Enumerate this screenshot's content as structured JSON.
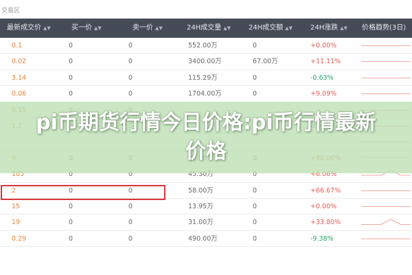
{
  "zone": {
    "title": "交易区"
  },
  "columns": [
    {
      "label": "最新成交价",
      "sortable": true
    },
    {
      "label": "买一价",
      "sortable": true
    },
    {
      "label": "卖一价",
      "sortable": true
    },
    {
      "label": "24H成交量",
      "sortable": true
    },
    {
      "label": "24H成交额",
      "sortable": true
    },
    {
      "label": "24H涨跌",
      "sortable": true
    },
    {
      "label": "价格趋势(3日)",
      "sortable": false
    }
  ],
  "rows": [
    {
      "price": "0.1",
      "buy": "0",
      "sell": "0",
      "volume": "552.00万",
      "amount": "0",
      "change": "+0.00%",
      "dir": "up",
      "trend": [
        0.5,
        0.5,
        0.5,
        0.5,
        0.5,
        0.5
      ]
    },
    {
      "price": "0.02",
      "buy": "0",
      "sell": "0",
      "volume": "3400.00万",
      "amount": "67.00万",
      "change": "+11.11%",
      "dir": "up",
      "trend": [
        0.5,
        0.5,
        0.5,
        0.5,
        0.5,
        0.5
      ]
    },
    {
      "price": "3.14",
      "buy": "0",
      "sell": "0",
      "volume": "115.29万",
      "amount": "0",
      "change": "-0.63%",
      "dir": "down",
      "trend": [
        0.5,
        0.5,
        0.5,
        0.5,
        0.5,
        0.5
      ]
    },
    {
      "price": "0.06",
      "buy": "0",
      "sell": "0",
      "volume": "1704.00万",
      "amount": "0",
      "change": "+9.09%",
      "dir": "up",
      "trend": [
        0.5,
        0.5,
        0.5,
        0.5,
        0.5,
        0.5
      ]
    },
    {
      "price": "0.15",
      "buy": "0",
      "sell": "0",
      "volume": "",
      "amount": "",
      "change": "",
      "dir": "up",
      "trend": [
        0.5,
        0.5,
        0.5,
        0.5,
        0.5,
        0.5
      ]
    },
    {
      "price": "1.2",
      "buy": "0",
      "sell": "0",
      "volume": "",
      "amount": "",
      "change": "-89.09%",
      "dir": "down",
      "trend": [
        0.5,
        0.5,
        0.5,
        0.5,
        0.5,
        0.5
      ]
    },
    {
      "price": "",
      "buy": "",
      "sell": "",
      "volume": "",
      "amount": "",
      "change": "",
      "dir": "up",
      "trend": [
        0.5,
        0.5,
        0.5,
        0.5,
        0.5,
        0.5
      ]
    },
    {
      "price": "9",
      "buy": "0",
      "sell": "0",
      "volume": "55.30万",
      "amount": "0",
      "change": "+80.00%",
      "dir": "up",
      "trend": [
        0.4,
        0.4,
        0.4,
        0.4,
        0.4,
        0.4
      ]
    },
    {
      "price": "105",
      "buy": "0",
      "sell": "0",
      "volume": "45.30万",
      "amount": "0",
      "change": "+6.06%",
      "dir": "up",
      "trend": [
        0.6,
        0.6,
        0.6,
        0.1,
        0.6,
        0.6
      ]
    },
    {
      "price": "2",
      "buy": "0",
      "sell": "0",
      "volume": "58.00万",
      "amount": "0",
      "change": "+66.67%",
      "dir": "up",
      "trend": [
        0.5,
        0.5,
        0.5,
        0.5,
        0.5,
        0.5
      ]
    },
    {
      "price": "15",
      "buy": "0",
      "sell": "0",
      "volume": "13.95万",
      "amount": "0",
      "change": "+0.00%",
      "dir": "up",
      "trend": [
        0.5,
        0.5,
        0.5,
        0.5,
        0.5,
        0.5
      ]
    },
    {
      "price": "19",
      "buy": "0",
      "sell": "0",
      "volume": "31.00万",
      "amount": "0",
      "change": "+33.80%",
      "dir": "up",
      "trend": [
        0.7,
        0.7,
        0.7,
        0.2,
        0.7,
        0.7
      ]
    },
    {
      "price": "0.29",
      "buy": "0",
      "sell": "0",
      "volume": "490.00万",
      "amount": "0",
      "change": "-9.38%",
      "dir": "down",
      "trend": [
        0.5,
        0.5,
        0.5,
        0.5,
        0.5,
        0.5
      ]
    }
  ],
  "banner": {
    "text": "pi币期货行情今日价格:pi币行情最新价格"
  },
  "colors": {
    "header_bg": "#454b57",
    "price": "#e8833a",
    "up": "#e85c4f",
    "down": "#2aa36c",
    "highlight": "#d9343a",
    "banner_bg": "#bee1b4"
  }
}
